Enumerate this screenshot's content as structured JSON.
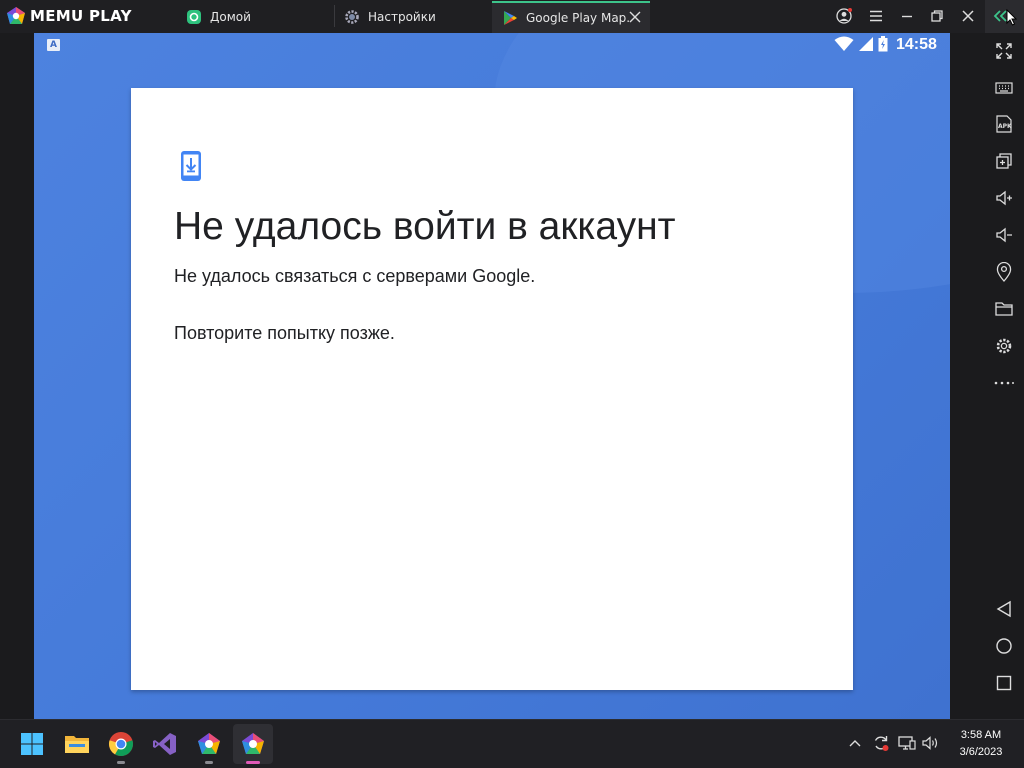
{
  "app": {
    "name": "MEMU PLAY",
    "tabs": [
      {
        "label": "Домой",
        "icon": "memu-home-icon"
      },
      {
        "label": "Настройки",
        "icon": "settings-gear-icon"
      },
      {
        "label": "Google Play Map.",
        "icon": "google-play-icon",
        "active": true
      }
    ]
  },
  "status_bar": {
    "time": "14:58",
    "left_badge": "A"
  },
  "dialog": {
    "icon": "phone-download-icon",
    "title": "Не удалось войти в аккаунт",
    "message": "Не удалось связаться с серверами Google.",
    "retry": "Повторите попытку позже."
  },
  "sidebar": {
    "items": [
      "fullscreen-icon",
      "keyboard-icon",
      "apk-icon",
      "multi-instance-icon",
      "volume-up-icon",
      "volume-down-icon",
      "location-icon",
      "folder-icon",
      "settings-icon",
      "more-icon"
    ],
    "nav": [
      "back-icon",
      "home-icon",
      "recents-icon"
    ],
    "apk_label": "APK"
  },
  "taskbar": {
    "apps": [
      "windows-start-icon",
      "file-explorer-icon",
      "chrome-icon",
      "visual-studio-icon",
      "memu-multi-icon",
      "memu-player-icon"
    ],
    "time": "3:58 AM",
    "date": "3/6/2023"
  },
  "colors": {
    "accent": "#3dc48b",
    "android_bg": "#4a7fdc",
    "dialog_icon": "#4285f4"
  }
}
